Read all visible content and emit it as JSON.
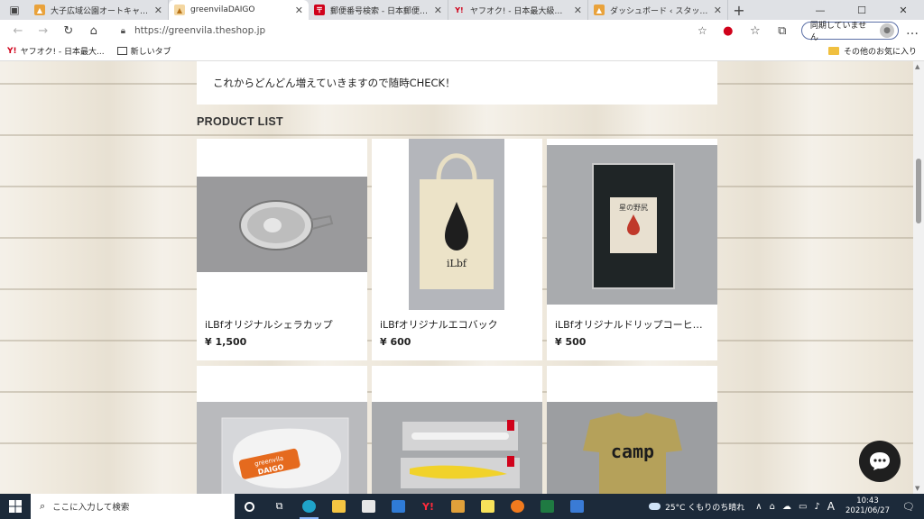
{
  "browser": {
    "tabs": [
      {
        "title": "大子広域公園オートキャンプ場 グ",
        "favicon": "grn-badge",
        "active": false
      },
      {
        "title": "greenvilaDAIGO",
        "favicon": "camp-badge",
        "active": true
      },
      {
        "title": "郵便番号検索 - 日本郵便株式会",
        "favicon": "jp-post",
        "active": false
      },
      {
        "title": "ヤフオク! - 日本最大級のネットオーク",
        "favicon": "yahoo-y",
        "active": false
      },
      {
        "title": "ダッシュボード ‹ スタッフブログ – グリン",
        "favicon": "grn-badge",
        "active": false
      }
    ],
    "new_tab_symbol": "+",
    "url": "https://greenvila.theshop.jp",
    "sync_label": "同期していません",
    "favorites": [
      {
        "label": "ヤフオク! - 日本最大...",
        "icon": "yahoo-y"
      },
      {
        "label": "新しいタブ",
        "icon": "tab-icon"
      }
    ],
    "other_favorites": "その他のお気に入り"
  },
  "page": {
    "notice": "これからどんどん増えていきますので随時CHECK！",
    "section_title": "PRODUCT LIST",
    "products": [
      {
        "name": "iLBfオリジナルシェラカップ",
        "price": "¥ 1,500",
        "image": "sierra-cup"
      },
      {
        "name": "iLBfオリジナルエコバック",
        "price": "¥ 600",
        "image": "eco-bag"
      },
      {
        "name": "iLBfオリジナルドリップコーヒ…",
        "price": "¥ 500",
        "image": "drip-coffee"
      },
      {
        "name": "",
        "price": "",
        "image": "face-mask",
        "mask_text_1": "greenvila",
        "mask_text_2": "DAIGO"
      },
      {
        "name": "",
        "price": "",
        "image": "cutlery-pack"
      },
      {
        "name": "",
        "price": "",
        "image": "camp-tshirt",
        "shirt_text": "camp"
      }
    ],
    "eco_bag_text": "iLbf",
    "coffee_label": "星の野尻",
    "chat_icon": "chat-bubble-icon"
  },
  "taskbar": {
    "search_placeholder": "ここに入力して検索",
    "weather": "25°C くもりのち晴れ",
    "ime": "A",
    "time": "10:43",
    "date": "2021/06/27"
  },
  "colors": {
    "accent": "#0078d4",
    "page_background": "#efe9dd",
    "taskbar": "#1c2a3a",
    "chat_button": "#1f1f1f"
  }
}
